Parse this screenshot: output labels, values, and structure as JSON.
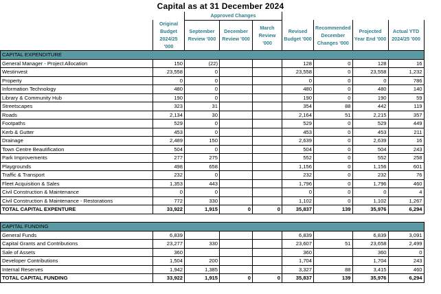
{
  "title": "Capital as at 31 December 2024",
  "approved_group": "Approved Changes",
  "columns": [
    "Original Budget 2024/25 '000",
    "September Review '000",
    "December Review '000",
    "March Review '000",
    "Revised Budget '000",
    "Recommended December Changes '000",
    "Projected Year End '000",
    "Actual YTD 2024/25 '000"
  ],
  "expenditure": {
    "heading": "CAPITAL EXPENDITURE",
    "rows": [
      {
        "label": "General Manager - Project Allocation",
        "v": [
          "150",
          "(22)",
          "",
          "",
          "128",
          "0",
          "128",
          "16"
        ]
      },
      {
        "label": "Westinvest",
        "v": [
          "23,558",
          "0",
          "",
          "",
          "23,558",
          "0",
          "23,558",
          "1,232"
        ]
      },
      {
        "label": "Property",
        "v": [
          "0",
          "0",
          "",
          "",
          "0",
          "0",
          "0",
          "786"
        ]
      },
      {
        "label": "Information Technology",
        "v": [
          "480",
          "0",
          "",
          "",
          "480",
          "0",
          "480",
          "140"
        ]
      },
      {
        "label": "Library & Community Hub",
        "v": [
          "190",
          "0",
          "",
          "",
          "190",
          "0",
          "190",
          "59"
        ]
      },
      {
        "label": "Streetscapes",
        "v": [
          "323",
          "31",
          "",
          "",
          "354",
          "88",
          "442",
          "119"
        ]
      },
      {
        "label": "Roads",
        "v": [
          "2,134",
          "30",
          "",
          "",
          "2,164",
          "51",
          "2,215",
          "357"
        ]
      },
      {
        "label": "Footpaths",
        "v": [
          "529",
          "0",
          "",
          "",
          "529",
          "0",
          "529",
          "449"
        ]
      },
      {
        "label": "Kerb & Gutter",
        "v": [
          "453",
          "0",
          "",
          "",
          "453",
          "0",
          "453",
          "211"
        ]
      },
      {
        "label": "Drainage",
        "v": [
          "2,489",
          "150",
          "",
          "",
          "2,639",
          "0",
          "2,639",
          "16"
        ]
      },
      {
        "label": "Town Centre Beautification",
        "v": [
          "504",
          "0",
          "",
          "",
          "504",
          "0",
          "504",
          "243"
        ]
      },
      {
        "label": "Park Improvements",
        "v": [
          "277",
          "275",
          "",
          "",
          "552",
          "0",
          "552",
          "258"
        ]
      },
      {
        "label": "Playgrounds",
        "v": [
          "498",
          "658",
          "",
          "",
          "1,156",
          "0",
          "1,156",
          "601"
        ]
      },
      {
        "label": "Traffic & Transport",
        "v": [
          "232",
          "0",
          "",
          "",
          "232",
          "0",
          "232",
          "76"
        ]
      },
      {
        "label": "Fleet Acquisition & Sales",
        "v": [
          "1,353",
          "443",
          "",
          "",
          "1,796",
          "0",
          "1,796",
          "460"
        ]
      },
      {
        "label": "Civil Construction & Maintenance",
        "v": [
          "0",
          "0",
          "",
          "",
          "0",
          "0",
          "0",
          "4"
        ]
      },
      {
        "label": "Civil Construction & Maintenance - Restorations",
        "v": [
          "772",
          "330",
          "",
          "",
          "1,102",
          "0",
          "1,102",
          "1,267"
        ]
      }
    ],
    "total": {
      "label": "TOTAL CAPITAL EXPENTURE",
      "v": [
        "33,922",
        "1,915",
        "0",
        "0",
        "35,837",
        "139",
        "35,976",
        "6,294"
      ]
    }
  },
  "funding": {
    "heading": "CAPITAL FUNDING",
    "rows": [
      {
        "label": "General Funds",
        "v": [
          "6,839",
          "",
          "",
          "",
          "6,839",
          "",
          "6,839",
          "3,091"
        ]
      },
      {
        "label": "Capital Grants and Contributions",
        "v": [
          "23,277",
          "330",
          "",
          "",
          "23,607",
          "51",
          "23,658",
          "2,499"
        ]
      },
      {
        "label": "Sale of Assets",
        "v": [
          "360",
          "",
          "",
          "",
          "360",
          "",
          "360",
          "0"
        ]
      },
      {
        "label": "Developer Contributions",
        "v": [
          "1,504",
          "200",
          "",
          "",
          "1,704",
          "",
          "1,704",
          "243"
        ]
      },
      {
        "label": "Internal Reserves",
        "v": [
          "1,942",
          "1,385",
          "",
          "",
          "3,327",
          "88",
          "3,415",
          "460"
        ]
      }
    ],
    "total": {
      "label": "TOTAL CAPITAL FUNDING",
      "v": [
        "33,922",
        "1,915",
        "0",
        "0",
        "35,837",
        "139",
        "35,976",
        "6,294"
      ]
    }
  }
}
